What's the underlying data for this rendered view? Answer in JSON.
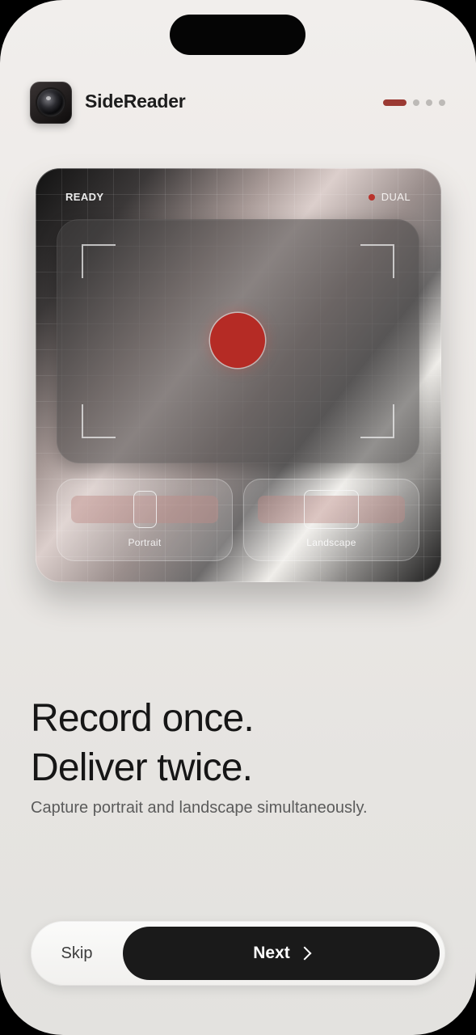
{
  "app": {
    "name": "SideReader",
    "icon": "camera-lens-icon"
  },
  "pagination": {
    "total": 4,
    "current": 1,
    "active_color": "#9b3a33"
  },
  "preview": {
    "status": "READY",
    "badge": "DUAL",
    "badge_dot_color": "#b9332c",
    "record_color": "#b52b25",
    "modes": [
      {
        "label": "Portrait",
        "icon": "portrait-frame-icon"
      },
      {
        "label": "Landscape",
        "icon": "landscape-frame-icon"
      }
    ]
  },
  "headline": {
    "line1": "Record once.",
    "line2": "Deliver twice."
  },
  "subtitle": "Capture portrait and landscape simultaneously.",
  "actions": {
    "skip_label": "Skip",
    "next_label": "Next",
    "next_icon": "chevron-right-icon"
  }
}
